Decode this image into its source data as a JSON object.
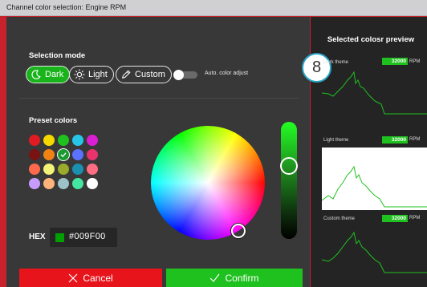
{
  "window": {
    "title": "Channel color selection: Engine RPM"
  },
  "selection_mode": {
    "heading": "Selection mode",
    "modes": [
      {
        "label": "Dark",
        "icon": "moon-icon",
        "active": true
      },
      {
        "label": "Light",
        "icon": "sun-icon",
        "active": false
      },
      {
        "label": "Custom",
        "icon": "pencil-icon",
        "active": false
      }
    ],
    "auto_adjust_label": "Auto. color adjust"
  },
  "badge": {
    "value": "8"
  },
  "preset": {
    "heading": "Preset colors",
    "colors": [
      [
        "#e01b24",
        "#f5d800",
        "#1fc11f",
        "#27c6e8",
        "#d91fd1"
      ],
      [
        "#7a1212",
        "#f08214",
        "#1b9a32",
        "#5a72ff",
        "#e8336d"
      ],
      [
        "#ff6a4d",
        "#f2f278",
        "#9aaa2a",
        "#1a8fb0",
        "#ff6d82"
      ],
      [
        "#c69cff",
        "#ffb37a",
        "#9dc2c8",
        "#45e6a2",
        "#ffffff"
      ]
    ],
    "selected": "#1b9a32"
  },
  "hex": {
    "label": "HEX",
    "value": "#009F00",
    "color": "#009f00"
  },
  "buttons": {
    "cancel": "Cancel",
    "confirm": "Confirm"
  },
  "preview": {
    "title": "Selected colosr preview",
    "themes": [
      {
        "name": "Dark theme",
        "value": "32000",
        "unit": "RPM",
        "bg": "#242424"
      },
      {
        "name": "Light theme",
        "value": "32000",
        "unit": "RPM",
        "bg": "#ffffff"
      },
      {
        "name": "Custom theme",
        "value": "32000",
        "unit": "RPM",
        "bg": "#242424"
      }
    ],
    "line_color": "#1fc11f"
  }
}
